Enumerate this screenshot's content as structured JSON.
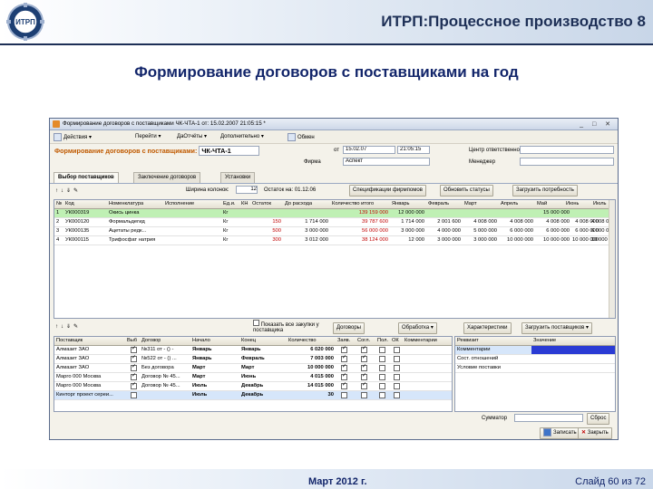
{
  "slide": {
    "title": "ИТРП:Процессное производство 8",
    "subtitle": "Формирование договоров с поставщиками на год",
    "logo_text": "ИТРП",
    "footer_date": "Март 2012 г.",
    "footer_slide": "Слайд 60 из 72"
  },
  "window": {
    "title": "Формирование договоров с поставщиками ЧК-ЧТА-1        от: 15.02.2007 21:05:15 *",
    "toolbar": [
      "Действия ▾",
      "Перейти ▾",
      "ДаОтчёты ▾",
      "Дополнительно ▾",
      "Обмен"
    ],
    "form_title": "Формирование договоров с поставщиками:",
    "doc_number": "ЧК-ЧТА-1",
    "date_label": "от",
    "date_value": "15.02.07",
    "time_value": "21:05:15",
    "center_label": "Центр ответственности:",
    "firm_label": "Фирма",
    "firm_value": "Аспект",
    "manager_label": "Менеджер"
  },
  "tabs": [
    "Выбор поставщиков",
    "Заключение договоров",
    "Установки"
  ],
  "toolbar2": {
    "width_label": "Ширина колонок:",
    "width_value": "12",
    "remain_label": "Остаток на: 01.12.06",
    "spec_btn": "Спецификации фирмпомов",
    "refresh_btn": "Обновить статусы",
    "load_btn": "Загрузить потребность"
  },
  "grid1": {
    "headers": [
      "№",
      "Код",
      "Номенклатура",
      "Исполнение",
      "Ед.и.",
      "КН",
      "Остаток",
      "До расхода",
      "Количество итого",
      "Январь",
      "Февраль",
      "Март",
      "Апрель",
      "Май",
      "Июнь",
      "Июль"
    ],
    "rows": [
      {
        "n": "1",
        "code": "УК000319",
        "name": "Окись цинка",
        "ex": "",
        "unit": "Кг",
        "kn": "",
        "rest": "",
        "dorash": "",
        "total": "139 159 000",
        "m": [
          "12 000 000",
          "",
          "",
          "",
          "15 000 000",
          "",
          ""
        ],
        "style": "row-green"
      },
      {
        "n": "2",
        "code": "УК000120",
        "name": "Формальдегид",
        "ex": "",
        "unit": "Кг",
        "kn": "",
        "rest": "150",
        "dorash": "1 714 000",
        "total": "39 787 600",
        "m": [
          "1 714 000",
          "2 001 600",
          "4 008 000",
          "4 008 000",
          "4 008 000",
          "4 008 000",
          "4 008 000"
        ],
        "style": ""
      },
      {
        "n": "3",
        "code": "УК000135",
        "name": "Ацетаты редк...",
        "ex": "",
        "unit": "Кг",
        "kn": "",
        "rest": "500",
        "dorash": "3 000 000",
        "total": "56 000 000",
        "m": [
          "3 000 000",
          "4 000 000",
          "5 000 000",
          "6 000 000",
          "6 000 000",
          "6 000 000",
          "6 000 000"
        ],
        "style": ""
      },
      {
        "n": "4",
        "code": "УК000115",
        "name": "Трифосфат натрия",
        "ex": "",
        "unit": "Кг",
        "kn": "",
        "rest": "300",
        "dorash": "3 012 000",
        "total": "38 124 000",
        "m": [
          "12 000",
          "3 000 000",
          "3 000 000",
          "10 000 000",
          "10 000 000",
          "10 000 000",
          "10 000 000"
        ],
        "style": ""
      }
    ]
  },
  "toolbar3": {
    "show_all": "Показать все закупки у поставщика",
    "contracts_btn": "Договоры",
    "process_btn": "Обработка ▾",
    "charact_btn": "Характеристики",
    "load_sup_btn": "Загрузить поставщиков ▾"
  },
  "grid2": {
    "headers": [
      "Поставщик",
      "Выб",
      "Договор",
      "Начало",
      "Конец",
      "Количество",
      "Заяв.",
      "Согл.",
      "Пол.",
      "ОК",
      "Комментарии"
    ],
    "rows": [
      {
        "sup": "Алмазит ЗАО",
        "chk": true,
        "dog": "№311 от - () -",
        "start": "Январь",
        "end": "Январь",
        "qty": "6 020 000",
        "a": true,
        "b": true,
        "c": false,
        "d": false,
        "style": ""
      },
      {
        "sup": "Алмазит ЗАО",
        "chk": true,
        "dog": "№522 от - () ...",
        "start": "Январь",
        "end": "Февраль",
        "qty": "7 003 000",
        "a": true,
        "b": true,
        "c": false,
        "d": false,
        "style": ""
      },
      {
        "sup": "Алмазит ЗАО",
        "chk": true,
        "dog": "Без договора",
        "start": "Март",
        "end": "Март",
        "qty": "10 000 000",
        "a": true,
        "b": true,
        "c": false,
        "d": false,
        "style": ""
      },
      {
        "sup": "Марго 000 Москва",
        "chk": true,
        "dog": "Договор № 45...",
        "start": "Март",
        "end": "Июнь",
        "qty": "4 015 000",
        "a": true,
        "b": true,
        "c": false,
        "d": false,
        "style": ""
      },
      {
        "sup": "Марго 000 Москва",
        "chk": true,
        "dog": "Договор № 45...",
        "start": "Июль",
        "end": "Декабрь",
        "qty": "14 015 000",
        "a": true,
        "b": true,
        "c": false,
        "d": false,
        "style": ""
      },
      {
        "sup": "Кинторг проект сереи...",
        "chk": false,
        "dog": "",
        "start": "Июль",
        "end": "Декабрь",
        "qty": "30",
        "a": false,
        "b": false,
        "c": false,
        "d": false,
        "style": "row-blue"
      }
    ]
  },
  "grid3": {
    "headers": [
      "Реквизит",
      "Значение"
    ],
    "rows": [
      "Комментарии",
      "Сост. отношений",
      "Условие поставки"
    ]
  },
  "bottom": {
    "sum_label": "Сумматор",
    "reset_btn": "Сброс",
    "save_btn": "Записать",
    "close_btn": "Закрыть"
  }
}
